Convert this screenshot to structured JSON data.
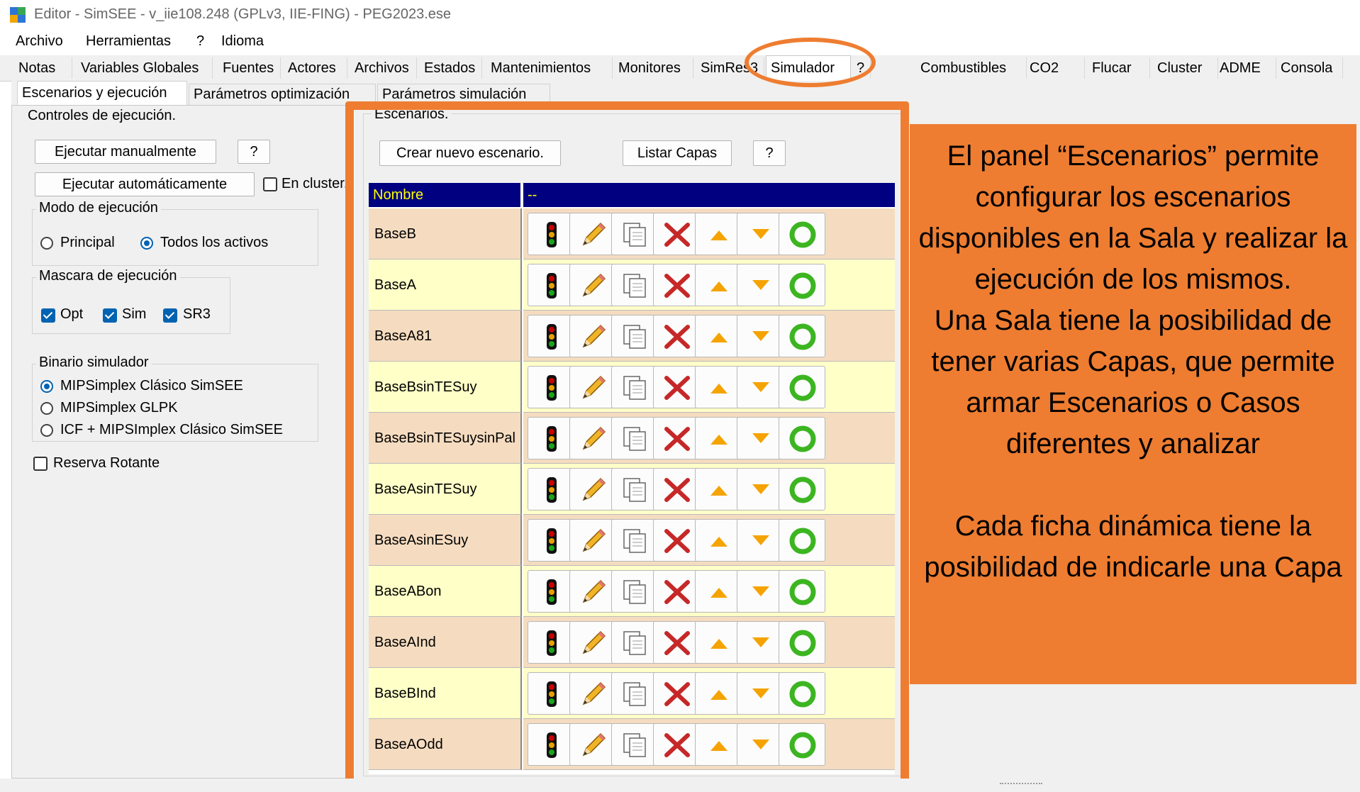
{
  "window": {
    "title": "Editor - SimSEE - v_iie108.248 (GPLv3, IIE-FING) - PEG2023.ese"
  },
  "menu": [
    "Archivo",
    "Herramientas",
    "?",
    "Idioma"
  ],
  "main_tabs": [
    "Notas",
    "Variables Globales",
    "Fuentes",
    "Actores",
    "Archivos",
    "Estados",
    "Mantenimientos",
    "Monitores",
    "SimRes3",
    "Simulador",
    "?",
    "Combustibles",
    "CO2",
    "Flucar",
    "Cluster",
    "ADME",
    "Consola"
  ],
  "active_main_tab": "Simulador",
  "sub_tabs": [
    "Escenarios y ejecución",
    "Parámetros optimización",
    "Parámetros simulación"
  ],
  "active_sub_tab": "Escenarios y ejecución",
  "controls": {
    "group_title": "Controles de ejecución.",
    "run_manual": "Ejecutar manualmente",
    "help1": "?",
    "run_auto": "Ejecutar automáticamente",
    "en_cluster": "En cluster.",
    "modo": {
      "title": "Modo de ejecución",
      "options": [
        "Principal",
        "Todos los activos"
      ],
      "selected": "Todos los activos"
    },
    "mascara": {
      "title": "Mascara de ejecución",
      "options": [
        "Opt",
        "Sim",
        "SR3"
      ],
      "checked": [
        true,
        true,
        true
      ]
    },
    "binario": {
      "title": "Binario simulador",
      "options": [
        "MIPSimplex Clásico SimSEE",
        "MIPSimplex GLPK",
        "ICF + MIPSImplex Clásico SimSEE"
      ],
      "selected": "MIPSimplex Clásico SimSEE"
    },
    "reserva": "Reserva Rotante"
  },
  "scenarios": {
    "group_title": "Escenarios.",
    "new_button": "Crear nuevo escenario.",
    "list_button": "Listar Capas",
    "help": "?",
    "col_name": "Nombre",
    "col_actions": "--",
    "rows": [
      "BaseB",
      "BaseA",
      "BaseA81",
      "BaseBsinTESuy",
      "BaseBsinTESuysinPal",
      "BaseAsinTESuy",
      "BaseAsinESuy",
      "BaseABon",
      "BaseAInd",
      "BaseBInd",
      "BaseAOdd"
    ],
    "row_icons": [
      "traffic-light-icon",
      "pencil-icon",
      "copy-icon",
      "delete-icon",
      "move-up-icon",
      "move-down-icon",
      "active-toggle-icon"
    ]
  },
  "callout": {
    "text1": "El panel “Escenarios” permite configurar los escenarios disponibles en la Sala y realizar la ejecución de los mismos.\nUna Sala tiene la posibilidad de tener varias Capas, que permite armar Escenarios o Casos diferentes y analizar",
    "text2": "Cada ficha dinámica  tiene la posibilidad de indicarle una Capa"
  },
  "colors": {
    "highlight": "#ee7d31",
    "table_header_bg": "#000080",
    "table_header_fg": "#ffff00",
    "row_odd": "#f5dcc0",
    "row_even": "#ffffc8",
    "accent": "#0063b1"
  }
}
